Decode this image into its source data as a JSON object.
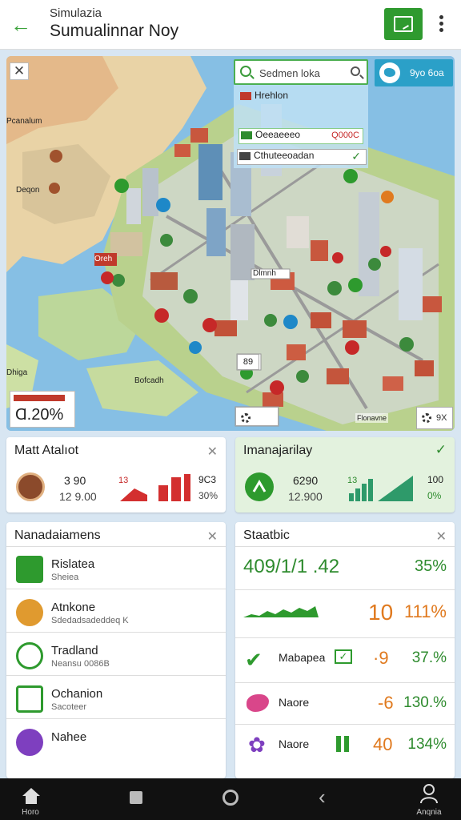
{
  "header": {
    "title_small": "Simulazia",
    "title_main": "Sumualinnar Noy",
    "back_icon": "arrow-left-icon",
    "screen_icon": "screen-icon",
    "menu_icon": "more-vertical-icon"
  },
  "map": {
    "search_text": "Sedmen loka",
    "suggestions": [
      {
        "label": "Hrehlon"
      },
      {
        "label": "Oeeaeeeo",
        "tag": "Q000C"
      },
      {
        "label": "Cthuteeoadan"
      }
    ],
    "weather_text": "9yo 6oa",
    "labels": [
      "Pcanalum",
      "Deqon",
      "Oreh",
      "Dhiga",
      "Dlmnh",
      "Bofcadh"
    ],
    "percent_value": "Ɑ.20%",
    "zoom_text": "9X",
    "ctrl_text": "89",
    "near_tag": "Flonavne"
  },
  "card_a": {
    "title": "Matt Atalıot",
    "num1": "3 90",
    "num2": "12 9.00",
    "small": "13",
    "right1": "9C3",
    "right2": "30%"
  },
  "card_b": {
    "title": "Imanajarilay",
    "num1": "6290",
    "num2": "12.900",
    "small": "13",
    "right1": "100",
    "right2": "0%"
  },
  "card_c": {
    "title": "Nanadaiamens",
    "items": [
      {
        "title": "Rislatea",
        "sub": "Sheiea"
      },
      {
        "title": "Atnkone",
        "sub": "Sdedadsadeddeq K"
      },
      {
        "title": "Tradland",
        "sub": "Neansu 0086B"
      },
      {
        "title": "Ochanion",
        "sub": "Sacoteer"
      },
      {
        "title": "Nahee",
        "sub": ""
      }
    ]
  },
  "card_d": {
    "title": "Staatbic",
    "big": "409/1/1 .42",
    "big_pct": "35%",
    "rows": [
      {
        "label": "",
        "delta": "10",
        "pct": "111%"
      },
      {
        "label": "Mabapea",
        "delta": "·9",
        "pct": "37.%"
      },
      {
        "label": "Naore",
        "delta": "-6",
        "pct": "130.%"
      },
      {
        "label": "Naore",
        "delta": "40",
        "pct": "134%"
      }
    ]
  },
  "nav": {
    "items": [
      {
        "label": "Horo",
        "icon": "home-icon"
      },
      {
        "label": "",
        "icon": "square-icon"
      },
      {
        "label": "",
        "icon": "circle-icon"
      },
      {
        "label": "",
        "icon": "chevron-left-icon"
      },
      {
        "label": "Anqnia",
        "icon": "user-icon"
      }
    ]
  },
  "colors": {
    "accent": "#2f9a2f",
    "warn": "#c62828",
    "orange": "#e07a1f"
  }
}
